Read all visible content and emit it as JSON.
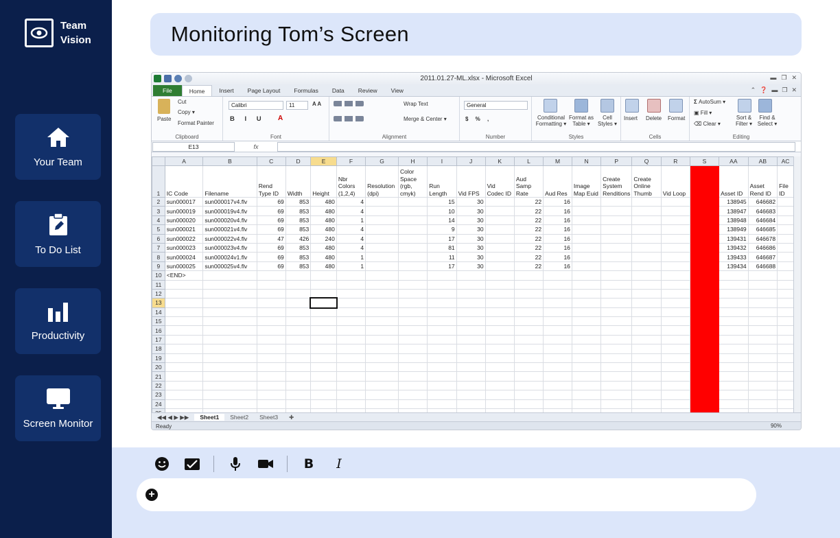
{
  "app": {
    "brand": [
      "Team",
      "Vision"
    ]
  },
  "sidebar": {
    "items": [
      {
        "label": "Your Team",
        "icon": "home-icon"
      },
      {
        "label": "To Do List",
        "icon": "clipboard-edit-icon"
      },
      {
        "label": "Productivity",
        "icon": "bar-chart-icon"
      },
      {
        "label": "Screen Monitor",
        "icon": "monitor-icon"
      }
    ]
  },
  "page": {
    "title": "Monitoring Tom’s Screen"
  },
  "excel": {
    "window_title": "2011.01.27-ML.xlsx - Microsoft Excel",
    "tabs": [
      "File",
      "Home",
      "Insert",
      "Page Layout",
      "Formulas",
      "Data",
      "Review",
      "View"
    ],
    "active_tab": "Home",
    "ribbon": {
      "clipboard": {
        "label": "Clipboard",
        "paste": "Paste",
        "cut": "Cut",
        "copy": "Copy ▾",
        "format_painter": "Format Painter"
      },
      "font": {
        "label": "Font",
        "font_name": "Calibri",
        "font_size": "11"
      },
      "alignment": {
        "label": "Alignment",
        "wrap_text": "Wrap Text",
        "merge_center": "Merge & Center ▾"
      },
      "number": {
        "label": "Number",
        "format": "General"
      },
      "styles": {
        "label": "Styles",
        "conditional": "Conditional Formatting ▾",
        "format_table": "Format as Table ▾",
        "cell_styles": "Cell Styles ▾"
      },
      "cells": {
        "label": "Cells",
        "insert": "Insert",
        "delete": "Delete",
        "format": "Format"
      },
      "editing": {
        "label": "Editing",
        "autosum": "AutoSum ▾",
        "fill": "Fill ▾",
        "clear": "Clear ▾",
        "sort": "Sort & Filter ▾",
        "find": "Find & Select ▾"
      }
    },
    "name_box": "E13",
    "fx": "fx",
    "columns": [
      "A",
      "B",
      "C",
      "D",
      "E",
      "F",
      "G",
      "H",
      "I",
      "J",
      "K",
      "L",
      "M",
      "N",
      "P",
      "Q",
      "R",
      "S",
      "AA",
      "AB",
      "AC"
    ],
    "headers": [
      "IC Code",
      "Filename",
      "Rend Type ID",
      "Width",
      "Height",
      "Nbr Colors (1,2,4)",
      "Resolution (dpi)",
      "Color Space (rgb, cmyk)",
      "Run Length",
      "Vid FPS",
      "Vid Codec ID",
      "Aud Samp Rate",
      "Aud Res",
      "Image Map Euid",
      "Create System Renditions",
      "Create Online Thumb",
      "Vid Loop",
      "",
      "Asset ID",
      "Asset Rend ID",
      "File ID"
    ],
    "rows": [
      [
        "sun000017",
        "sun000017v4.flv",
        "69",
        "853",
        "480",
        "4",
        "",
        "",
        "15",
        "30",
        "",
        "22",
        "16",
        "",
        "",
        "",
        "",
        "",
        "138945",
        "646682",
        ""
      ],
      [
        "sun000019",
        "sun000019v4.flv",
        "69",
        "853",
        "480",
        "4",
        "",
        "",
        "10",
        "30",
        "",
        "22",
        "16",
        "",
        "",
        "",
        "",
        "",
        "138947",
        "646683",
        ""
      ],
      [
        "sun000020",
        "sun000020v4.flv",
        "69",
        "853",
        "480",
        "1",
        "",
        "",
        "14",
        "30",
        "",
        "22",
        "16",
        "",
        "",
        "",
        "",
        "",
        "138948",
        "646684",
        ""
      ],
      [
        "sun000021",
        "sun000021v4.flv",
        "69",
        "853",
        "480",
        "4",
        "",
        "",
        "9",
        "30",
        "",
        "22",
        "16",
        "",
        "",
        "",
        "",
        "",
        "138949",
        "646685",
        ""
      ],
      [
        "sun000022",
        "sun000022v4.flv",
        "47",
        "426",
        "240",
        "4",
        "",
        "",
        "17",
        "30",
        "",
        "22",
        "16",
        "",
        "",
        "",
        "",
        "",
        "139431",
        "646678",
        ""
      ],
      [
        "sun000023",
        "sun000023v4.flv",
        "69",
        "853",
        "480",
        "4",
        "",
        "",
        "81",
        "30",
        "",
        "22",
        "16",
        "",
        "",
        "",
        "",
        "",
        "139432",
        "646686",
        ""
      ],
      [
        "sun000024",
        "sun000024v1.flv",
        "69",
        "853",
        "480",
        "1",
        "",
        "",
        "11",
        "30",
        "",
        "22",
        "16",
        "",
        "",
        "",
        "",
        "",
        "139433",
        "646687",
        ""
      ],
      [
        "sun000025",
        "sun000025v4.flv",
        "69",
        "853",
        "480",
        "1",
        "",
        "",
        "17",
        "30",
        "",
        "22",
        "16",
        "",
        "",
        "",
        "",
        "",
        "139434",
        "646688",
        ""
      ]
    ],
    "end_marker": "<END>",
    "sheet_tabs": [
      "Sheet1",
      "Sheet2",
      "Sheet3"
    ],
    "status": "Ready",
    "zoom": "90%"
  },
  "composer": {
    "tools": [
      "emoji-icon",
      "checkmark-card-icon",
      "microphone-icon",
      "video-camera-icon",
      "bold-icon",
      "italic-icon"
    ],
    "bold": "B",
    "italic": "I",
    "placeholder": ""
  },
  "colors": {
    "sidebar": "#0b1f4b",
    "nav_item": "#12306a",
    "title_bg": "#dce6fa",
    "highlight_column": "#ff0000"
  }
}
